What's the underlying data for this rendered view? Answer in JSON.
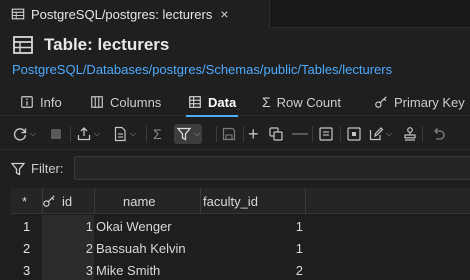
{
  "tab": {
    "label": "PostgreSQL/postgres: lecturers",
    "close": "×"
  },
  "header": {
    "title": "Table: lecturers",
    "breadcrumb": "PostgreSQL/Databases/postgres/Schemas/public/Tables/lecturers"
  },
  "view_tabs": [
    {
      "label": "Info",
      "icon": "info-icon"
    },
    {
      "label": "Columns",
      "icon": "columns-icon"
    },
    {
      "label": "Data",
      "icon": "table-icon",
      "active": true
    },
    {
      "label": "Row Count",
      "icon": "sigma-icon"
    },
    {
      "label": "Primary Key",
      "icon": "key-icon"
    }
  ],
  "toolbar": {
    "icons": [
      "refresh-icon",
      "stop-icon",
      "export-icon",
      "script-icon",
      "sigma-icon",
      "filter-icon",
      "save-icon",
      "add-row-icon",
      "copy-row-icon",
      "delete-row-icon",
      "details-icon",
      "inspect-icon",
      "edit-icon",
      "stamp-icon",
      "undo-icon"
    ]
  },
  "filter": {
    "label": "Filter:",
    "value": ""
  },
  "grid": {
    "corner": "*",
    "columns": [
      "id",
      "name",
      "faculty_id"
    ],
    "rows": [
      {
        "num": "1",
        "id": "1",
        "name": "Okai Wenger",
        "faculty_id": "1"
      },
      {
        "num": "2",
        "id": "2",
        "name": "Bassuah Kelvin",
        "faculty_id": "1"
      },
      {
        "num": "3",
        "id": "3",
        "name": "Mike Smith",
        "faculty_id": "2"
      }
    ]
  },
  "colors": {
    "accent": "#4daafc",
    "background": "#1f1f1f",
    "panel": "#252526"
  }
}
